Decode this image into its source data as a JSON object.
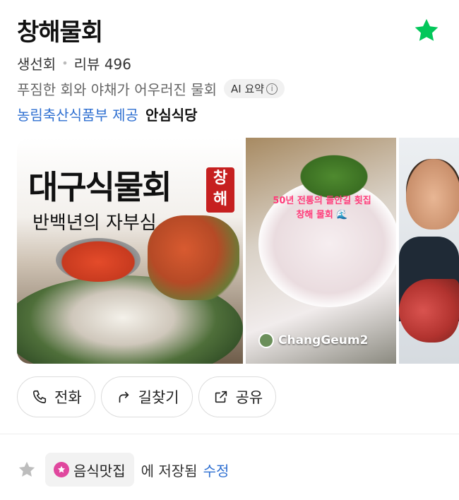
{
  "place": {
    "name": "창해물회",
    "category": "생선회",
    "review_label": "리뷰",
    "review_count": "496",
    "description": "푸짐한 회와 야채가 어우러진 물회",
    "ai_summary_label": "AI 요약",
    "provider_text": "농림축산식품부 제공",
    "provider_brand": "안심식당",
    "favorite_color": "#03c75a"
  },
  "gallery": {
    "photo1": {
      "title": "대구식물회",
      "badge": "창해",
      "subtitle": "반백년의 자부심"
    },
    "photo2": {
      "caption_line1": "50년 전통의 들안길 횟집",
      "caption_line2": "창해 물회 🌊",
      "author": "ChangGeum2"
    }
  },
  "actions": [
    {
      "label": "전화",
      "icon": "phone-icon"
    },
    {
      "label": "길찾기",
      "icon": "directions-icon"
    },
    {
      "label": "공유",
      "icon": "share-icon"
    }
  ],
  "saved": {
    "list_name": "음식맛집",
    "suffix": "에 저장됨",
    "edit_label": "수정"
  }
}
